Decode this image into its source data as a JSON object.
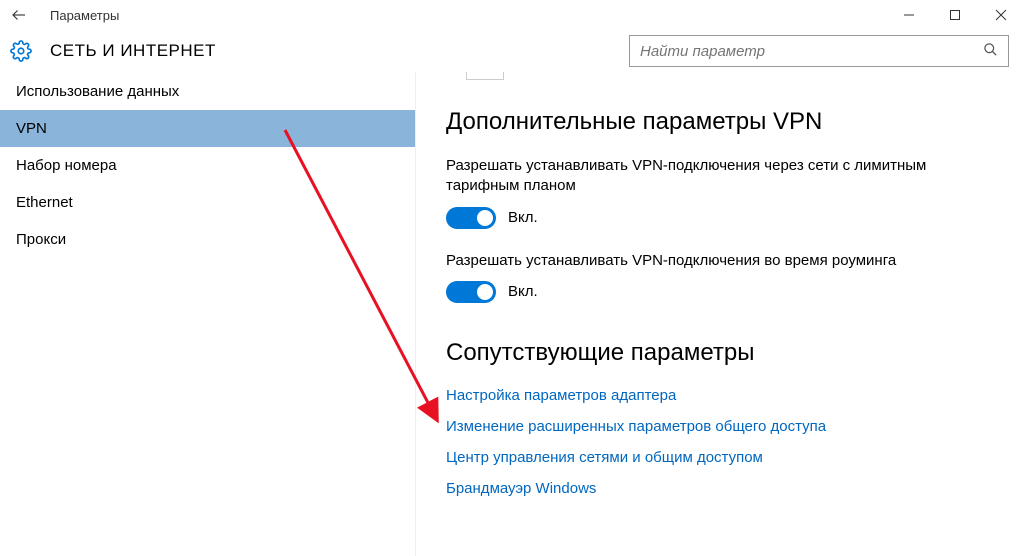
{
  "window": {
    "title": "Параметры"
  },
  "header": {
    "section": "СЕТЬ И ИНТЕРНЕТ",
    "search_placeholder": "Найти параметр"
  },
  "sidebar": {
    "items": [
      {
        "label": "Использование данных",
        "selected": false
      },
      {
        "label": "VPN",
        "selected": true
      },
      {
        "label": "Набор номера",
        "selected": false
      },
      {
        "label": "Ethernet",
        "selected": false
      },
      {
        "label": "Прокси",
        "selected": false
      }
    ]
  },
  "main": {
    "heading_advanced": "Дополнительные параметры VPN",
    "setting_metered": {
      "label": "Разрешать устанавливать VPN-подключения через сети с лимитным тарифным планом",
      "state": "Вкл.",
      "on": true
    },
    "setting_roaming": {
      "label": "Разрешать устанавливать VPN-подключения во время роуминга",
      "state": "Вкл.",
      "on": true
    },
    "heading_related": "Сопутствующие параметры",
    "links": [
      "Настройка параметров адаптера",
      "Изменение расширенных параметров общего доступа",
      "Центр управления сетями и общим доступом",
      "Брандмауэр Windows"
    ]
  }
}
